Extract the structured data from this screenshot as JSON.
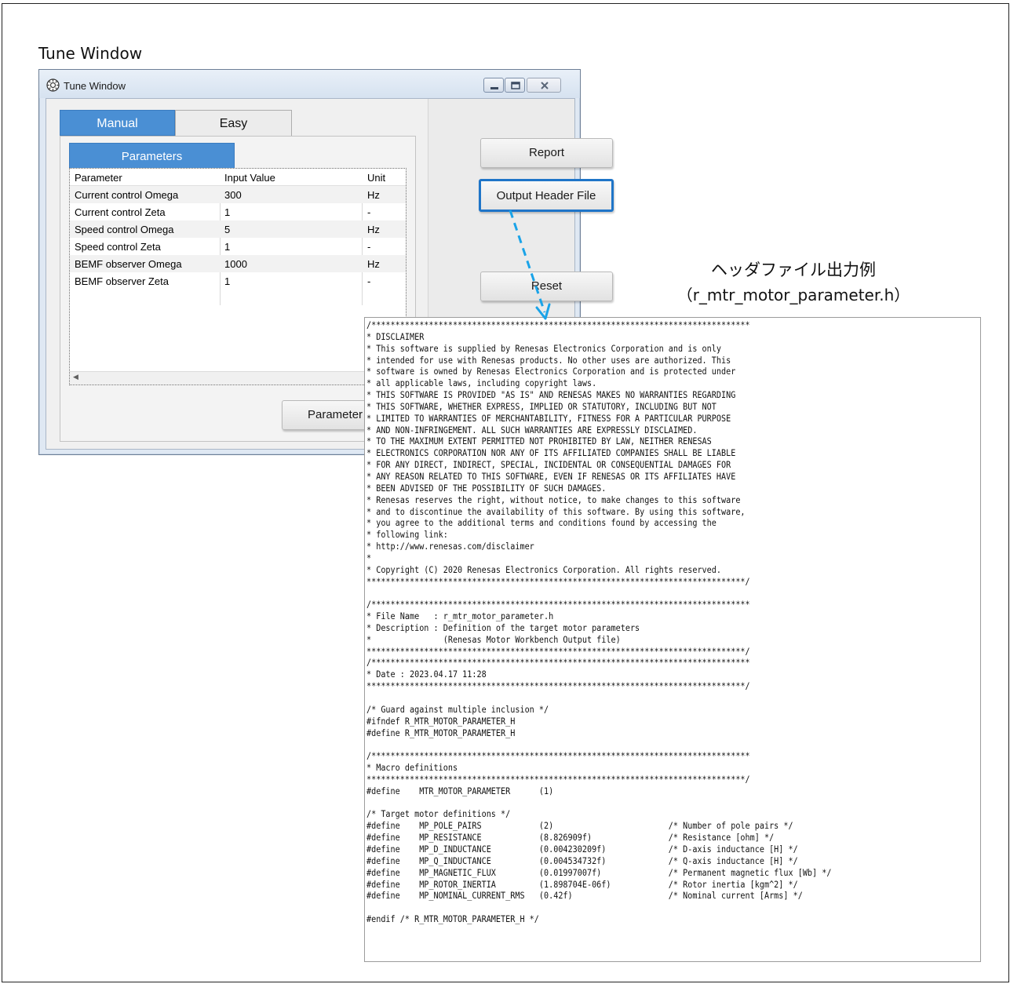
{
  "figure": {
    "caption": "Tune Window",
    "sample_title": "ヘッダファイル出力例",
    "sample_file": "（r_mtr_motor_parameter.h）"
  },
  "window": {
    "title": "Tune Window",
    "icons": {
      "app": "app-gear-icon",
      "minimize": "minimize-icon",
      "maximize": "maximize-icon",
      "close": "close-icon"
    },
    "tabs": [
      {
        "label": "Manual",
        "selected": true
      },
      {
        "label": "Easy",
        "selected": false
      }
    ],
    "subtab": "Parameters",
    "table": {
      "headers": [
        "Parameter",
        "Input Value",
        "Unit"
      ],
      "rows": [
        [
          "Current control Omega",
          "300",
          "Hz"
        ],
        [
          "Current control Zeta",
          "1",
          "-"
        ],
        [
          "Speed control Omega",
          "5",
          "Hz"
        ],
        [
          "Speed control Zeta",
          "1",
          "-"
        ],
        [
          "BEMF observer Omega",
          "1000",
          "Hz"
        ],
        [
          "BEMF observer Zeta",
          "1",
          "-"
        ]
      ]
    },
    "buttons": {
      "report": "Report",
      "output_header": "Output Header File",
      "reset": "Reset",
      "parameter": "Parameter"
    },
    "accent_color": "#4a8fd4",
    "highlight_color": "#1f75c8"
  },
  "header_file": {
    "lines": [
      "/*******************************************************************************",
      "* DISCLAIMER",
      "* This software is supplied by Renesas Electronics Corporation and is only",
      "* intended for use with Renesas products. No other uses are authorized. This",
      "* software is owned by Renesas Electronics Corporation and is protected under",
      "* all applicable laws, including copyright laws.",
      "* THIS SOFTWARE IS PROVIDED \"AS IS\" AND RENESAS MAKES NO WARRANTIES REGARDING",
      "* THIS SOFTWARE, WHETHER EXPRESS, IMPLIED OR STATUTORY, INCLUDING BUT NOT",
      "* LIMITED TO WARRANTIES OF MERCHANTABILITY, FITNESS FOR A PARTICULAR PURPOSE",
      "* AND NON-INFRINGEMENT. ALL SUCH WARRANTIES ARE EXPRESSLY DISCLAIMED.",
      "* TO THE MAXIMUM EXTENT PERMITTED NOT PROHIBITED BY LAW, NEITHER RENESAS",
      "* ELECTRONICS CORPORATION NOR ANY OF ITS AFFILIATED COMPANIES SHALL BE LIABLE",
      "* FOR ANY DIRECT, INDIRECT, SPECIAL, INCIDENTAL OR CONSEQUENTIAL DAMAGES FOR",
      "* ANY REASON RELATED TO THIS SOFTWARE, EVEN IF RENESAS OR ITS AFFILIATES HAVE",
      "* BEEN ADVISED OF THE POSSIBILITY OF SUCH DAMAGES.",
      "* Renesas reserves the right, without notice, to make changes to this software",
      "* and to discontinue the availability of this software. By using this software,",
      "* you agree to the additional terms and conditions found by accessing the",
      "* following link:",
      "* http://www.renesas.com/disclaimer",
      "*",
      "* Copyright (C) 2020 Renesas Electronics Corporation. All rights reserved.",
      "*******************************************************************************/",
      "",
      "/*******************************************************************************",
      "* File Name   : r_mtr_motor_parameter.h",
      "* Description : Definition of the target motor parameters",
      "*               (Renesas Motor Workbench Output file)",
      "*******************************************************************************/",
      "/*******************************************************************************",
      "* Date : 2023.04.17 11:28",
      "*******************************************************************************/",
      "",
      "/* Guard against multiple inclusion */",
      "#ifndef R_MTR_MOTOR_PARAMETER_H",
      "#define R_MTR_MOTOR_PARAMETER_H",
      "",
      "/*******************************************************************************",
      "* Macro definitions",
      "*******************************************************************************/",
      "#define    MTR_MOTOR_PARAMETER      (1)",
      "",
      "/* Target motor definitions */",
      "#define    MP_POLE_PAIRS            (2)                        /* Number of pole pairs */",
      "#define    MP_RESISTANCE            (8.826909f)                /* Resistance [ohm] */",
      "#define    MP_D_INDUCTANCE          (0.004230209f)             /* D-axis inductance [H] */",
      "#define    MP_Q_INDUCTANCE          (0.004534732f)             /* Q-axis inductance [H] */",
      "#define    MP_MAGNETIC_FLUX         (0.01997007f)              /* Permanent magnetic flux [Wb] */",
      "#define    MP_ROTOR_INERTIA         (1.898704E-06f)            /* Rotor inertia [kgm^2] */",
      "#define    MP_NOMINAL_CURRENT_RMS   (0.42f)                    /* Nominal current [Arms] */",
      "",
      "#endif /* R_MTR_MOTOR_PARAMETER_H */"
    ]
  }
}
